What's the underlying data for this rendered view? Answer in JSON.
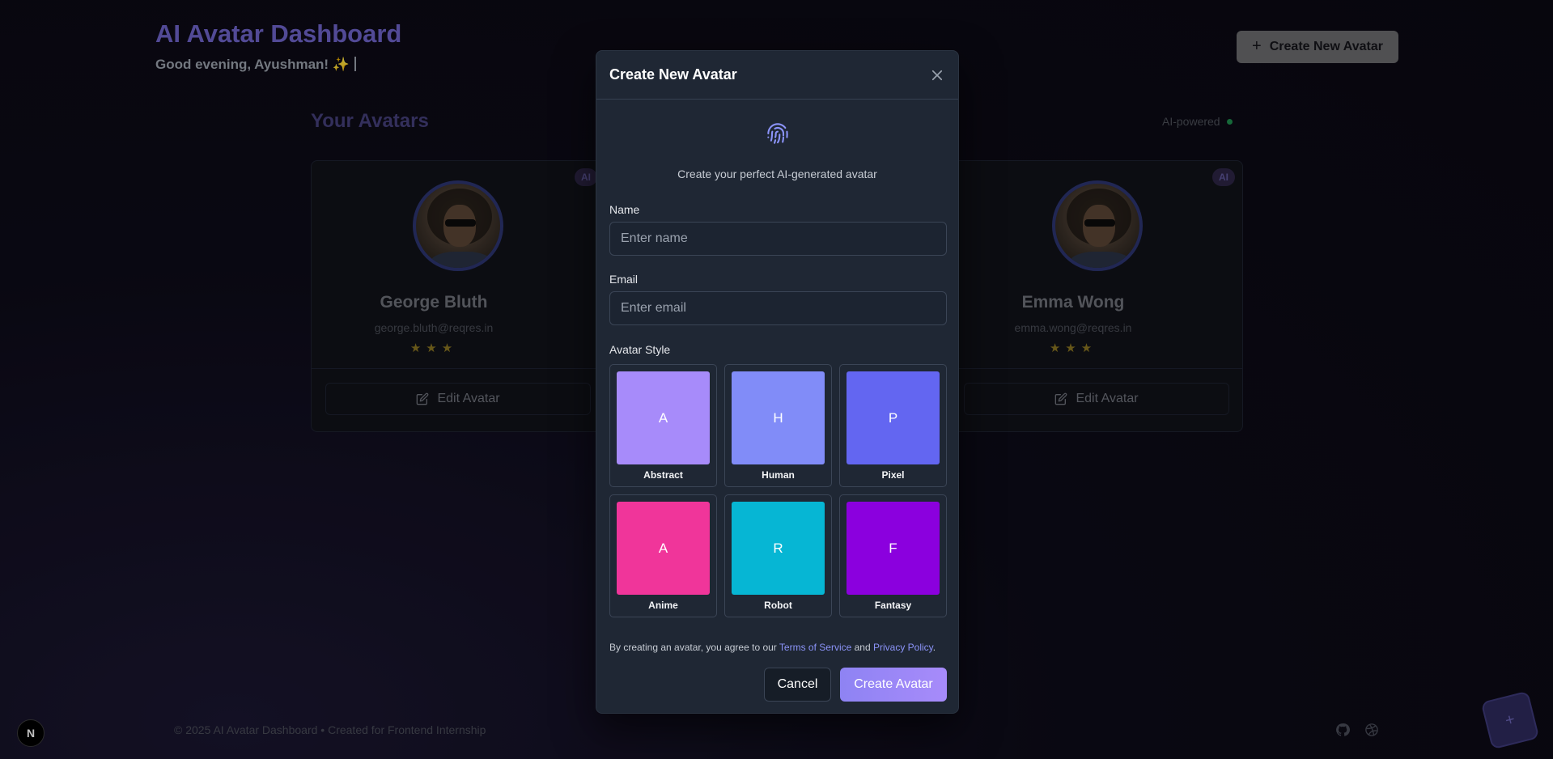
{
  "header": {
    "title": "AI Avatar Dashboard",
    "greeting": "Good evening, Ayushman! ✨",
    "create_button_label": "Create New Avatar"
  },
  "section": {
    "title": "Your Avatars",
    "ai_powered_label": "AI-powered"
  },
  "cards": [
    {
      "badge": "AI",
      "name": "George Bluth",
      "email": "george.bluth@reqres.in",
      "stars": "★★★",
      "edit_label": "Edit Avatar"
    },
    {
      "badge": "AI",
      "name": "Emma Wong",
      "email": "emma.wong@reqres.in",
      "stars": "★★★",
      "edit_label": "Edit Avatar"
    }
  ],
  "footer": {
    "text": "© 2025 AI Avatar Dashboard • Created for Frontend Internship",
    "badge_letter": "N"
  },
  "modal": {
    "title": "Create New Avatar",
    "subtitle": "Create your perfect AI-generated avatar",
    "name_label": "Name",
    "name_placeholder": "Enter name",
    "email_label": "Email",
    "email_placeholder": "Enter email",
    "style_label": "Avatar Style",
    "styles": [
      {
        "letter": "A",
        "name": "Abstract",
        "color": "#a78bfa"
      },
      {
        "letter": "H",
        "name": "Human",
        "color": "#818cf8"
      },
      {
        "letter": "P",
        "name": "Pixel",
        "color": "#6366f1"
      },
      {
        "letter": "A",
        "name": "Anime",
        "color": "#f0359a"
      },
      {
        "letter": "R",
        "name": "Robot",
        "color": "#06b6d4"
      },
      {
        "letter": "F",
        "name": "Fantasy",
        "color": "#8b00de"
      }
    ],
    "terms_prefix": "By creating an avatar, you agree to our ",
    "terms_link": "Terms of Service",
    "terms_and": " and ",
    "privacy_link": "Privacy Policy",
    "terms_suffix": ".",
    "cancel_label": "Cancel",
    "submit_label": "Create Avatar"
  },
  "colors": {
    "accent": "#a78bfa",
    "modal_bg": "#1f2734",
    "link": "#8b93f8"
  }
}
